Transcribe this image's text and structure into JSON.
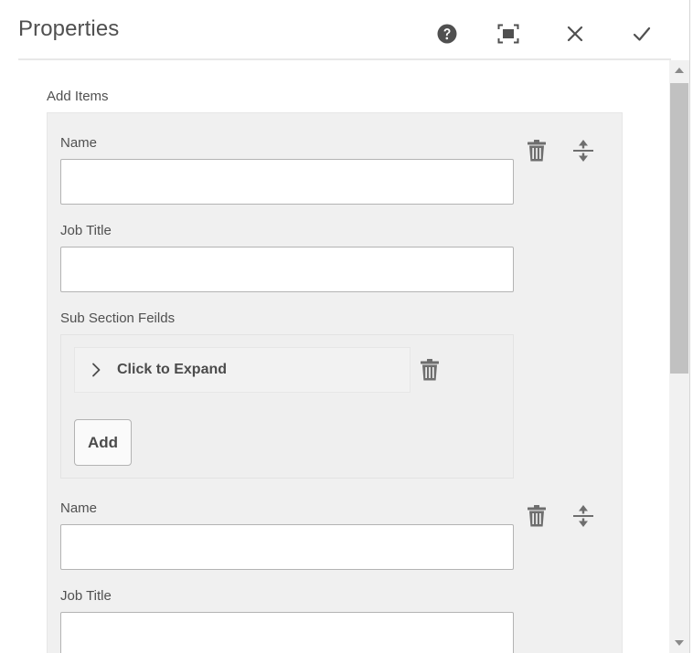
{
  "dialog": {
    "title": "Properties",
    "icons": {
      "help": "help-icon",
      "fullscreen": "fullscreen-icon",
      "close": "close-icon",
      "done": "checkmark-icon"
    }
  },
  "form": {
    "section_label": "Add Items",
    "items": [
      {
        "name_label": "Name",
        "name_value": "",
        "job_label": "Job Title",
        "job_value": "",
        "sub_section": {
          "label": "Sub Section Feilds",
          "collapsible_label": "Click to Expand",
          "add_label": "Add"
        }
      },
      {
        "name_label": "Name",
        "name_value": "",
        "job_label": "Job Title",
        "job_value": ""
      }
    ]
  },
  "colors": {
    "panel_bg": "#f0f0f0",
    "border": "#b3b3b3",
    "icon": "#6e6e6e",
    "text": "#505050"
  }
}
